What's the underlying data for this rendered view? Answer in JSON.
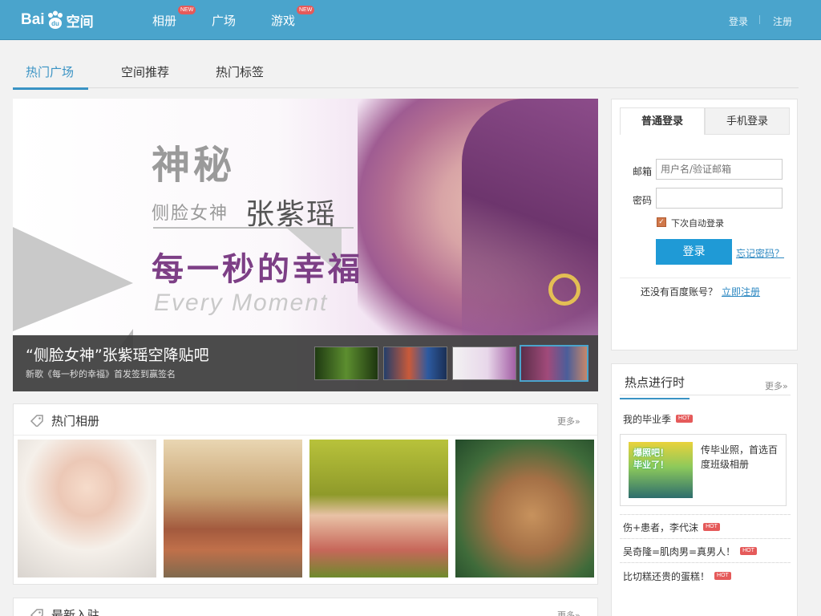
{
  "header": {
    "logo_text_a": "Bai",
    "logo_text_du": "du",
    "logo_text_b": "空间",
    "nav": [
      {
        "label": "相册",
        "badge": "NEW"
      },
      {
        "label": "广场",
        "badge": ""
      },
      {
        "label": "游戏",
        "badge": "NEW"
      }
    ],
    "login": "登录",
    "register": "注册",
    "brand_color": "#4aa4cc"
  },
  "tabs": [
    {
      "label": "热门广场",
      "active": true
    },
    {
      "label": "空间推荐",
      "active": false
    },
    {
      "label": "热门标签",
      "active": false
    }
  ],
  "banner": {
    "headline": "神秘",
    "subline": "侧脸女神",
    "name": "张紫瑶",
    "slogan": "每一秒的幸福",
    "english": "Every Moment",
    "caption_title": "“侧脸女神”张紫瑶空降贴吧",
    "caption_sub": "新歌《每一秒的幸福》首发签到赢签名",
    "thumbnails": [
      "thumb-1",
      "thumb-2",
      "thumb-3",
      "thumb-4"
    ],
    "active_thumb": 3
  },
  "login_panel": {
    "tab_normal": "普通登录",
    "tab_mobile": "手机登录",
    "email_label": "邮箱",
    "email_placeholder": "用户名/验证邮箱",
    "password_label": "密码",
    "remember_label": "下次自动登录",
    "remember_checked": true,
    "login_button": "登录",
    "forgot": "忘记密码？",
    "no_account": "还没有百度账号？",
    "register_now": "立即注册",
    "button_color": "#1f9ad6"
  },
  "hot_panel": {
    "title": "热点进行时",
    "more": "更多»",
    "badge": "HOT",
    "items": [
      {
        "label": "我的毕业季"
      },
      {
        "label": "伤+患者，李代沫"
      },
      {
        "label": "吴奇隆=肌肉男=真男人！"
      },
      {
        "label": "比切糕还贵的蛋糕！"
      }
    ],
    "card": {
      "image_text_1": "爆照吧！",
      "image_text_2": "毕业了！",
      "text": "传毕业照，首选百度班级相册"
    }
  },
  "albums": {
    "title": "热门相册",
    "more": "更多»",
    "photos": [
      "baby-photo",
      "living-room-photo",
      "girl-flowers-photo",
      "cat-photo"
    ]
  },
  "new_join": {
    "title": "最新入驻",
    "more": "更多»"
  }
}
